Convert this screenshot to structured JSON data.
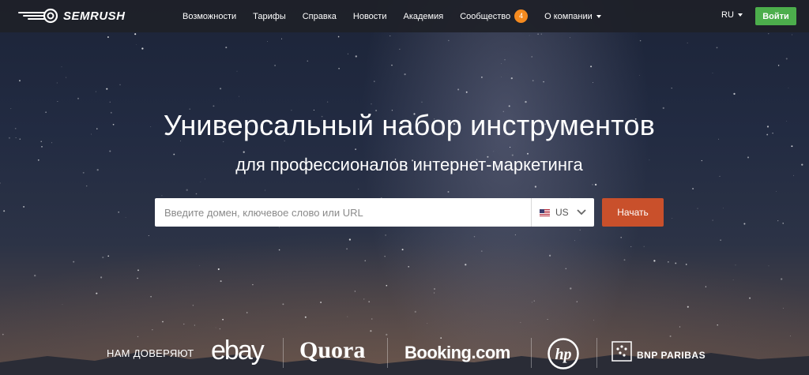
{
  "brand": {
    "name": "SEMRUSH",
    "logo_icon": "semrush-fireball-icon"
  },
  "nav": {
    "items": [
      {
        "label": "Возможности"
      },
      {
        "label": "Тарифы"
      },
      {
        "label": "Справка"
      },
      {
        "label": "Новости"
      },
      {
        "label": "Академия"
      },
      {
        "label": "Сообщество",
        "badge": "4"
      },
      {
        "label": "О компании",
        "dropdown": true
      }
    ],
    "language": "RU",
    "login_label": "Войти"
  },
  "hero": {
    "title": "Универсальный набор инструментов",
    "subtitle": "для профессионалов интернет-маркетинга"
  },
  "search": {
    "placeholder": "Введите домен, ключевое слово или URL",
    "value": "",
    "country": {
      "code": "US",
      "flag_icon": "us-flag-icon"
    },
    "submit_label": "Начать"
  },
  "trust": {
    "label": "НАМ ДОВЕРЯЮТ",
    "brands": [
      "ebay",
      "Quora",
      "Booking.com",
      "hp",
      "BNP PARIBAS"
    ]
  },
  "colors": {
    "topbar": "#1e2128",
    "login_button": "#4cae4c",
    "start_button": "#c9502b",
    "badge": "#f58b1f"
  }
}
